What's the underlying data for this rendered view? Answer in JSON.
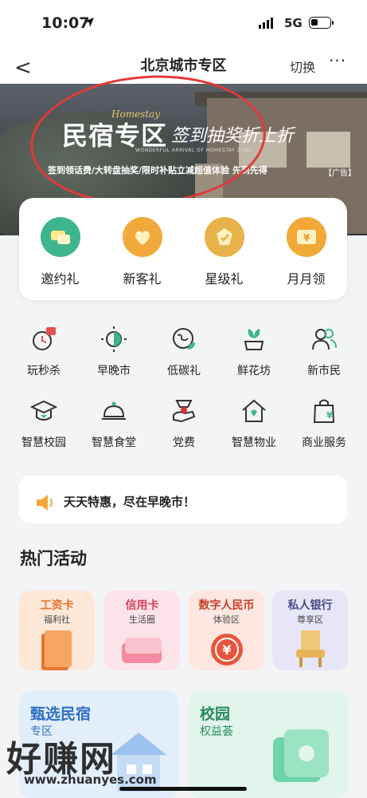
{
  "status_bar": {
    "time": "10:07",
    "network": "5G"
  },
  "nav": {
    "back_label": "<",
    "title": "北京城市专区",
    "switch_label": "切换",
    "more_label": "···"
  },
  "banner": {
    "title": "民宿专区",
    "handwriting": "签到抽奖折上折",
    "homestay_script": "Homestay",
    "wonderful": "WONDERFUL ARRIVAL OF HOMESTAY ZONE",
    "subline": "签到领话费/大转盘抽奖/限时补贴立减超值体验 先到先得",
    "ad_tag": "【广告】"
  },
  "top_card": [
    {
      "label": "邀约礼",
      "icon": "invite-gift-icon",
      "color": "#3fb58e"
    },
    {
      "label": "新客礼",
      "icon": "new-customer-gift-icon",
      "color": "#f2a93b"
    },
    {
      "label": "星级礼",
      "icon": "star-level-gift-icon",
      "color": "#e8b24a"
    },
    {
      "label": "月月领",
      "icon": "monthly-coupon-icon",
      "color": "#f0a836"
    }
  ],
  "grid": [
    {
      "label": "玩秒杀",
      "icon": "flash-sale-icon"
    },
    {
      "label": "早晚市",
      "icon": "day-night-market-icon"
    },
    {
      "label": "低碳礼",
      "icon": "low-carbon-gift-icon"
    },
    {
      "label": "鲜花坊",
      "icon": "flower-shop-icon"
    },
    {
      "label": "新市民",
      "icon": "new-citizen-icon"
    },
    {
      "label": "智慧校园",
      "icon": "smart-campus-icon"
    },
    {
      "label": "智慧食堂",
      "icon": "smart-canteen-icon"
    },
    {
      "label": "党费",
      "icon": "party-fee-icon"
    },
    {
      "label": "智慧物业",
      "icon": "smart-property-icon"
    },
    {
      "label": "商业服务",
      "icon": "business-service-icon"
    }
  ],
  "grid_badge": "秒",
  "notice": {
    "icon": "speaker-icon",
    "text": "天天特惠，尽在早晚市！"
  },
  "hot": {
    "title": "热门活动",
    "cards": [
      {
        "title": "工资卡",
        "subtitle": "福利社",
        "color": "#e8742f",
        "bg": "#fde8d8"
      },
      {
        "title": "信用卡",
        "subtitle": "生活圈",
        "color": "#d9415c",
        "bg": "#fce3ea"
      },
      {
        "title": "数字人民币",
        "subtitle": "体验区",
        "color": "#c8402a",
        "bg": "#fde7e0"
      },
      {
        "title": "私人银行",
        "subtitle": "尊享区",
        "color": "#4c4a8a",
        "bg": "#e6e6f6"
      }
    ],
    "big_cards": [
      {
        "title": "甄选民宿",
        "subtitle": "专区",
        "color": "#2f6fc4",
        "bg": "#e3eefb"
      },
      {
        "title": "校园",
        "subtitle": "权益荟",
        "color": "#2a8a63",
        "bg": "#e1f5ec"
      }
    ]
  },
  "watermark": {
    "text": "好赚网",
    "url": "www.zhuanyes.com"
  }
}
